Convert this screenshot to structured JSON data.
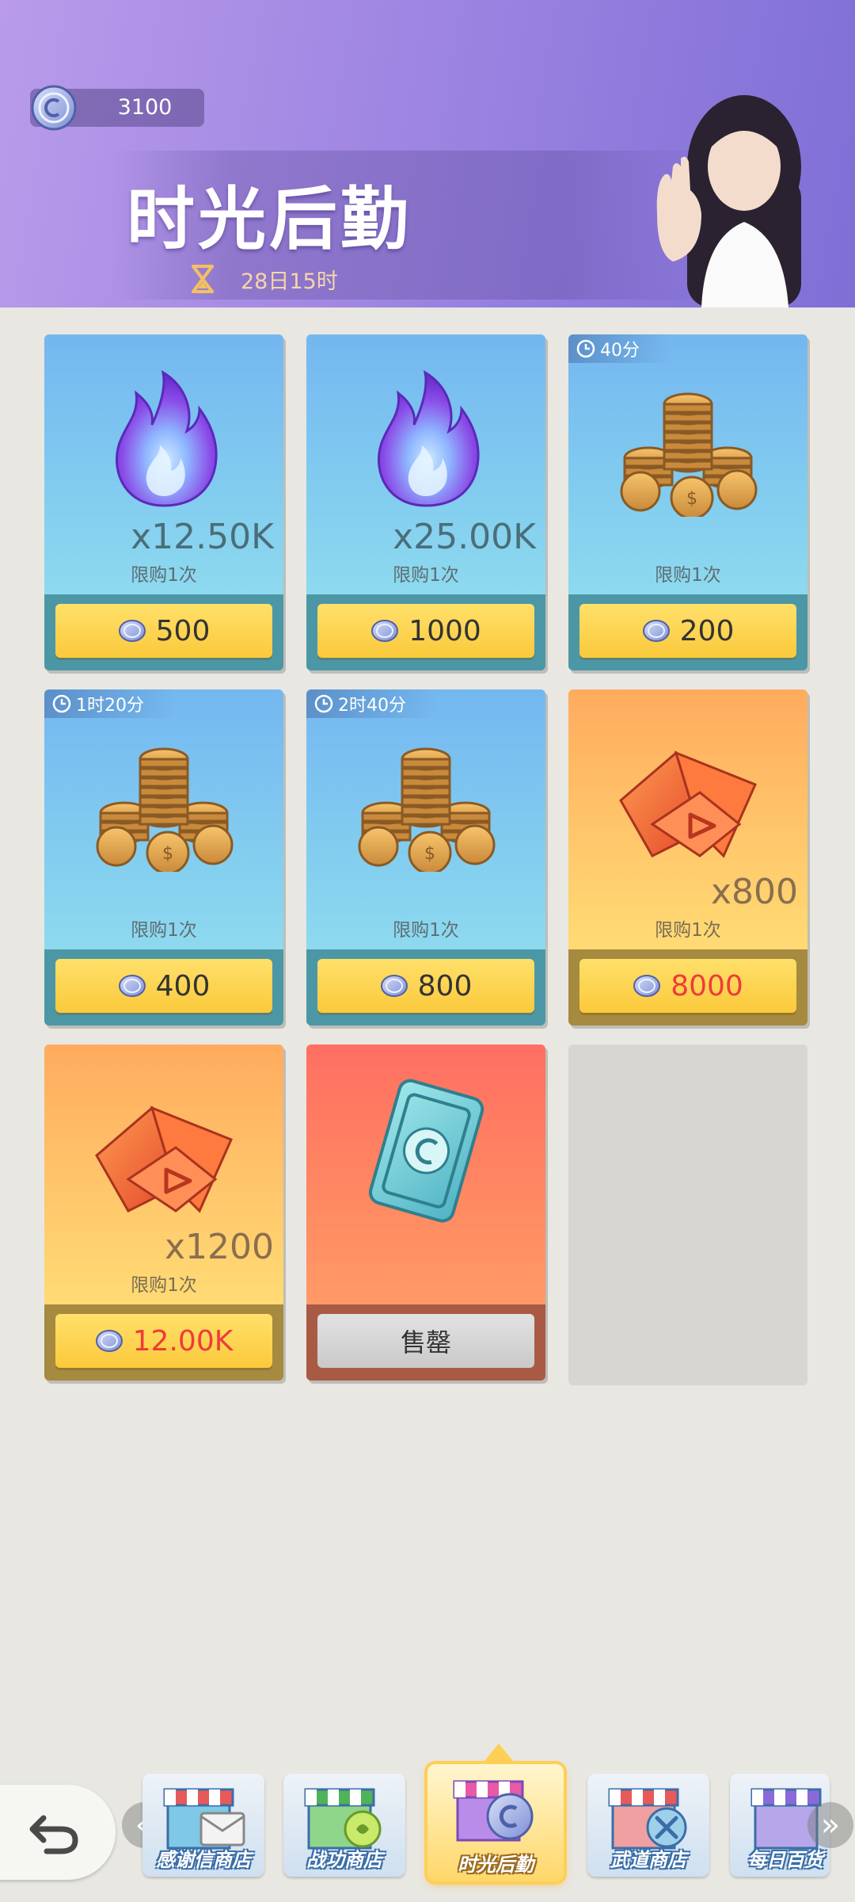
{
  "header": {
    "currency_amount": "3100",
    "title": "时光后勤",
    "timer": "28日15时"
  },
  "items": [
    {
      "quantity": "x12.50K",
      "limit": "限购1次",
      "price": "500",
      "icon": "purple-flame-icon"
    },
    {
      "quantity": "x25.00K",
      "limit": "限购1次",
      "price": "1000",
      "icon": "purple-flame-icon"
    },
    {
      "time_tag": "40分",
      "limit": "限购1次",
      "price": "200",
      "icon": "gold-coins-icon"
    },
    {
      "time_tag": "1时20分",
      "limit": "限购1次",
      "price": "400",
      "icon": "gold-coins-icon"
    },
    {
      "time_tag": "2时40分",
      "limit": "限购1次",
      "price": "800",
      "icon": "gold-coins-icon"
    },
    {
      "quantity": "x800",
      "limit": "限购1次",
      "price": "8000",
      "price_color": "#ee3b3b",
      "icon": "orange-crystal-icon"
    },
    {
      "quantity": "x1200",
      "limit": "限购1次",
      "price": "12.00K",
      "price_color": "#ee3b3b",
      "icon": "orange-crystal-icon"
    },
    {
      "soldout_label": "售罄",
      "icon": "blue-card-icon"
    }
  ],
  "nav": {
    "tabs": [
      {
        "label": "感谢信商店",
        "icon": "letter-shop-icon"
      },
      {
        "label": "战功商店",
        "icon": "merit-shop-icon"
      },
      {
        "label": "时光后勤",
        "icon": "time-shop-icon",
        "active": true
      },
      {
        "label": "武道商店",
        "icon": "martial-shop-icon"
      },
      {
        "label": "每日百货",
        "icon": "daily-shop-icon"
      }
    ]
  },
  "colors": {
    "header_start": "#b99bea",
    "header_end": "#7f6fd6",
    "price_button": "#fbc93b",
    "expensive_price": "#ee3b3b"
  }
}
